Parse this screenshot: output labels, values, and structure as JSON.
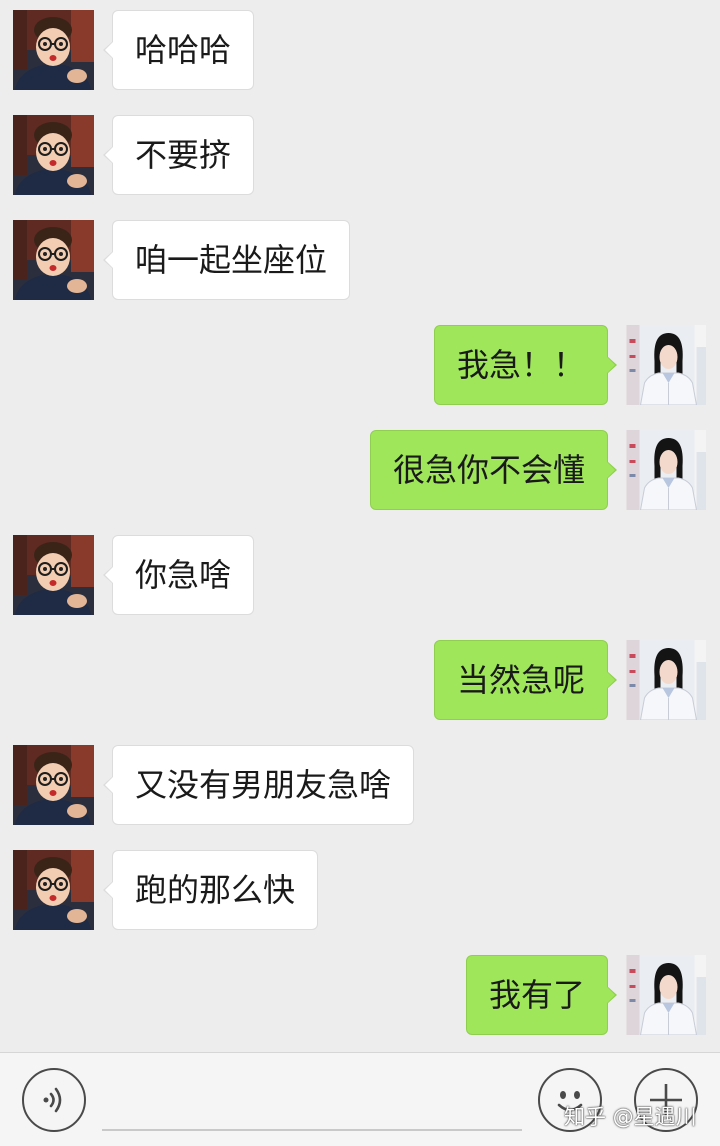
{
  "messages": [
    {
      "sender": "other",
      "text": "哈哈哈"
    },
    {
      "sender": "other",
      "text": "不要挤"
    },
    {
      "sender": "other",
      "text": "咱一起坐座位"
    },
    {
      "sender": "me",
      "text": "我急！！"
    },
    {
      "sender": "me",
      "text": "很急你不会懂"
    },
    {
      "sender": "other",
      "text": "你急啥"
    },
    {
      "sender": "me",
      "text": "当然急呢"
    },
    {
      "sender": "other",
      "text": "又没有男朋友急啥"
    },
    {
      "sender": "other",
      "text": "跑的那么快"
    },
    {
      "sender": "me",
      "text": "我有了"
    }
  ],
  "input": {
    "value": "",
    "placeholder": ""
  },
  "toolbar": {
    "voice_icon": "voice-icon",
    "emoji_icon": "emoji-icon",
    "plus_icon": "plus-icon"
  },
  "watermark": "知乎 @星遇川",
  "colors": {
    "background": "#ededed",
    "my_bubble": "#9fe65a",
    "their_bubble": "#ffffff",
    "bottom_bar": "#f5f5f6"
  }
}
